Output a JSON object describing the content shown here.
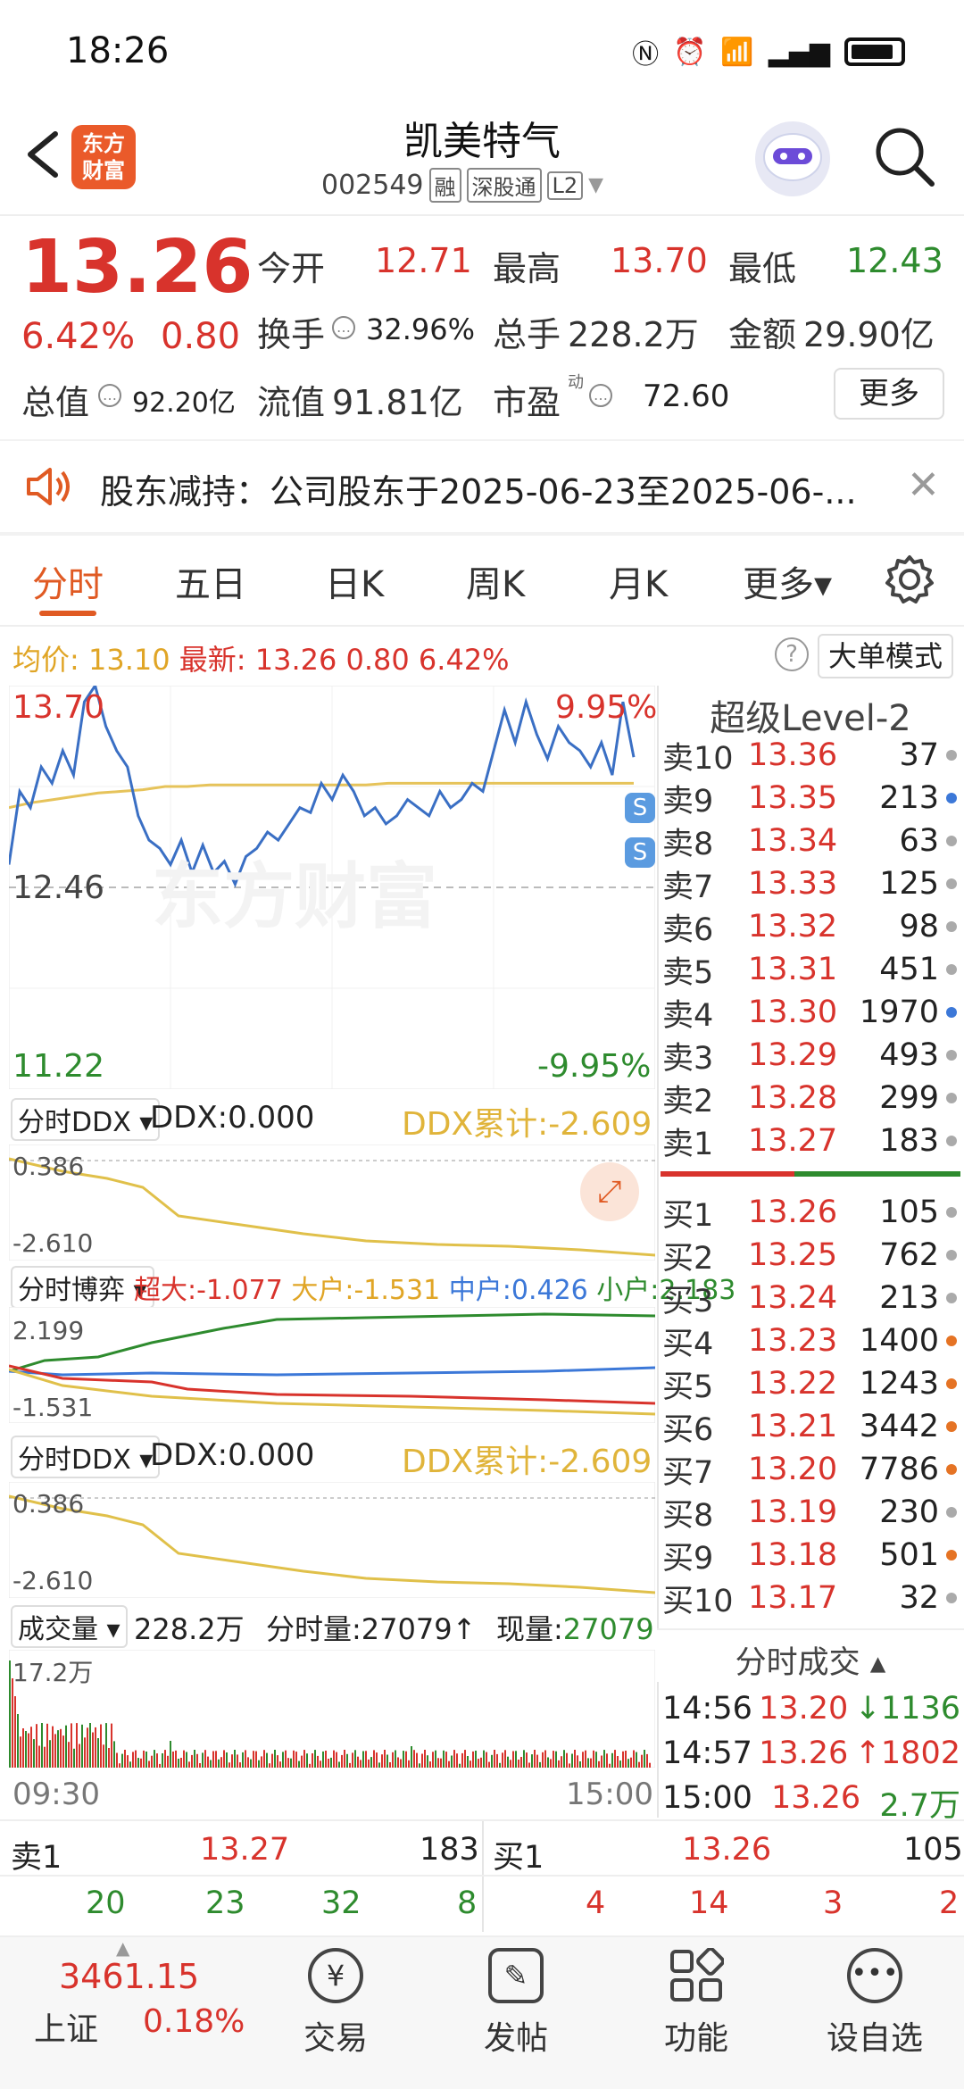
{
  "status": {
    "time": "18:26",
    "icons_text": "N ⏰ 6 ⁵ᴳ ▮▮▮"
  },
  "header": {
    "logo_text": "东方\n财富",
    "title": "凯美特气",
    "code": "002549",
    "tags": [
      "融",
      "深股通",
      "L2"
    ]
  },
  "quote": {
    "price": "13.26",
    "change_pct": "6.42%",
    "change": "0.80",
    "open_label": "今开",
    "open": "12.71",
    "high_label": "最高",
    "high": "13.70",
    "low_label": "最低",
    "low": "12.43",
    "turnover_label": "换手",
    "turnover": "32.96%",
    "volume_label": "总手",
    "volume": "228.2万",
    "amount_label": "金额",
    "amount": "29.90亿",
    "mktcap_label": "总值",
    "mktcap": "92.20亿",
    "float_label": "流值",
    "float_cap": "91.81亿",
    "pe_label": "市盈",
    "pe_sup": "动",
    "pe": "72.60",
    "more_label": "更多"
  },
  "notice": {
    "text": "股东减持：公司股东于2025-06-23至2025-06-..."
  },
  "tabs": [
    {
      "label": "分时",
      "active": true
    },
    {
      "label": "五日"
    },
    {
      "label": "日K"
    },
    {
      "label": "周K"
    },
    {
      "label": "月K"
    },
    {
      "label": "更多▾"
    }
  ],
  "avgbar": {
    "avg_label": "均价:",
    "avg": "13.10",
    "latest_label": "最新:",
    "latest": "13.26",
    "chg": "0.80",
    "pct": "6.42%",
    "big_mode": "大单模式"
  },
  "chart": {
    "y_top": "13.70",
    "y_mid": "12.46",
    "y_bot": "11.22",
    "pct_top": "9.95%",
    "pct_bot": "-9.95%",
    "watermark": "东方财富",
    "x_start": "09:30",
    "x_end": "15:00",
    "price_line": [
      12.6,
      13.05,
      12.95,
      13.2,
      13.1,
      13.3,
      13.15,
      13.6,
      13.7,
      13.45,
      13.3,
      13.2,
      12.9,
      12.75,
      12.7,
      12.6,
      12.75,
      12.55,
      12.72,
      12.55,
      12.62,
      12.48,
      12.65,
      12.7,
      12.8,
      12.75,
      12.85,
      12.95,
      12.92,
      13.1,
      13.0,
      13.15,
      13.05,
      12.9,
      12.95,
      12.85,
      12.9,
      13.0,
      12.95,
      12.9,
      13.05,
      12.95,
      13.0,
      13.1,
      13.05,
      13.3,
      13.55,
      13.35,
      13.6,
      13.4,
      13.25,
      13.45,
      13.35,
      13.3,
      13.2,
      13.35,
      13.15,
      13.6,
      13.26
    ],
    "avg_line": [
      12.95,
      12.98,
      13.0,
      13.02,
      13.04,
      13.05,
      13.06,
      13.08,
      13.08,
      13.09,
      13.09,
      13.09,
      13.09,
      13.09,
      13.09,
      13.09,
      13.09,
      13.1,
      13.1,
      13.1,
      13.1,
      13.1,
      13.1,
      13.1,
      13.1,
      13.1,
      13.1,
      13.1,
      13.1
    ]
  },
  "ddx1": {
    "select": "分时DDX ▾",
    "label": "DDX:0.000",
    "cum": "DDX累计:-2.609",
    "y_top": "0.386",
    "y_bot": "-2.610"
  },
  "game": {
    "select": "分时博弈 ▾",
    "super_label": "超大:-1.077",
    "big_label": "大户:-1.531",
    "mid_label": "中户:0.426",
    "small_label": "小户:2.183",
    "y_top": "2.199",
    "y_bot": "-1.531"
  },
  "ddx2": {
    "select": "分时DDX ▾",
    "label": "DDX:0.000",
    "cum": "DDX累计:-2.609",
    "y_top": "0.386",
    "y_bot": "-2.610"
  },
  "volume": {
    "select": "成交量 ▾",
    "total": "228.2万",
    "tick_label": "分时量:27079↑",
    "now_label": "现量:",
    "now": "27079",
    "y_top": "17.2万"
  },
  "level2": {
    "title": "超级Level-2",
    "asks": [
      {
        "label": "卖10",
        "price": "13.36",
        "vol": "37",
        "dot": "#aaaaaa"
      },
      {
        "label": "卖9",
        "price": "13.35",
        "vol": "213",
        "dot": "#3c78d8"
      },
      {
        "label": "卖8",
        "price": "13.34",
        "vol": "63",
        "dot": "#aaaaaa"
      },
      {
        "label": "卖7",
        "price": "13.33",
        "vol": "125",
        "dot": "#aaaaaa"
      },
      {
        "label": "卖6",
        "price": "13.32",
        "vol": "98",
        "dot": "#aaaaaa"
      },
      {
        "label": "卖5",
        "price": "13.31",
        "vol": "451",
        "dot": "#aaaaaa"
      },
      {
        "label": "卖4",
        "price": "13.30",
        "vol": "1970",
        "dot": "#3c78d8"
      },
      {
        "label": "卖3",
        "price": "13.29",
        "vol": "493",
        "dot": "#aaaaaa"
      },
      {
        "label": "卖2",
        "price": "13.28",
        "vol": "299",
        "dot": "#aaaaaa"
      },
      {
        "label": "卖1",
        "price": "13.27",
        "vol": "183",
        "dot": "#aaaaaa"
      }
    ],
    "bids": [
      {
        "label": "买1",
        "price": "13.26",
        "vol": "105",
        "dot": "#aaaaaa"
      },
      {
        "label": "买2",
        "price": "13.25",
        "vol": "762",
        "dot": "#aaaaaa"
      },
      {
        "label": "买3",
        "price": "13.24",
        "vol": "213",
        "dot": "#aaaaaa"
      },
      {
        "label": "买4",
        "price": "13.23",
        "vol": "1400",
        "dot": "#e57324"
      },
      {
        "label": "买5",
        "price": "13.22",
        "vol": "1243",
        "dot": "#e57324"
      },
      {
        "label": "买6",
        "price": "13.21",
        "vol": "3442",
        "dot": "#e57324"
      },
      {
        "label": "买7",
        "price": "13.20",
        "vol": "7786",
        "dot": "#e57324"
      },
      {
        "label": "买8",
        "price": "13.19",
        "vol": "230",
        "dot": "#aaaaaa"
      },
      {
        "label": "买9",
        "price": "13.18",
        "vol": "501",
        "dot": "#e57324"
      },
      {
        "label": "买10",
        "price": "13.17",
        "vol": "32",
        "dot": "#aaaaaa"
      }
    ],
    "trades_title": "分时成交 ▴",
    "trades": [
      {
        "time": "14:56",
        "price": "13.20",
        "vol": "↓1136",
        "color": "#2e8b2e"
      },
      {
        "time": "14:57",
        "price": "13.26",
        "vol": "↑1802",
        "color": "#d8332c"
      },
      {
        "time": "15:00",
        "price": "13.26",
        "vol": "2.7万",
        "color": "#2e8b2e"
      }
    ]
  },
  "strip": {
    "sell_label": "卖1",
    "sell_price": "13.27",
    "sell_vol": "183",
    "buy_label": "买1",
    "buy_price": "13.26",
    "buy_vol": "105",
    "sell_queue": [
      "20",
      "23",
      "32",
      "8"
    ],
    "buy_queue": [
      "4",
      "14",
      "3",
      "2"
    ]
  },
  "nav": {
    "index_value": "3461.15",
    "index_name": "上证",
    "index_pct": "0.18%",
    "items": [
      "交易",
      "发帖",
      "功能",
      "设自选"
    ]
  }
}
